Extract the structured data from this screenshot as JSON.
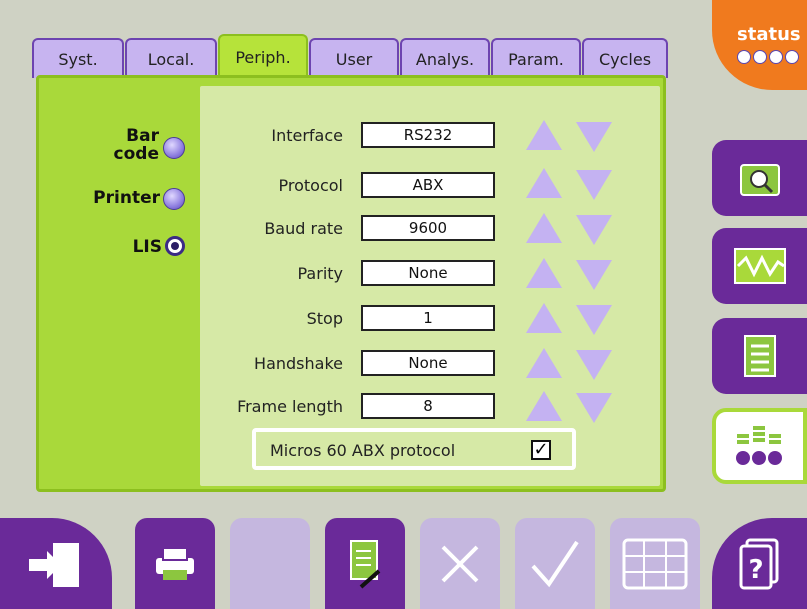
{
  "tabs": [
    "Syst.",
    "Local.",
    "Periph.",
    "User",
    "Analys.",
    "Param.",
    "Cycles"
  ],
  "active_tab": "Periph.",
  "peripherals": [
    {
      "label": "Bar code",
      "selected": false
    },
    {
      "label": "Printer",
      "selected": false
    },
    {
      "label": "LIS",
      "selected": true
    }
  ],
  "fields": [
    {
      "label": "Interface",
      "value": "RS232"
    },
    {
      "label": "Protocol",
      "value": "ABX"
    },
    {
      "label": "Baud rate",
      "value": "9600"
    },
    {
      "label": "Parity",
      "value": "None"
    },
    {
      "label": "Stop",
      "value": "1"
    },
    {
      "label": "Handshake",
      "value": "None"
    },
    {
      "label": "Frame length",
      "value": "8"
    }
  ],
  "checkbox": {
    "label": "Micros 60 ABX protocol",
    "checked": true
  },
  "status": {
    "label": "status"
  },
  "side_buttons": [
    "folder-search-icon",
    "waveform-icon",
    "list-icon",
    "settings-bars-icon"
  ],
  "bottom_buttons": [
    "exit-icon",
    "printer-icon",
    "blank",
    "document-edit-icon",
    "cancel-icon",
    "validate-icon",
    "keyboard-icon"
  ],
  "colors": {
    "accent_green": "#a9d93a",
    "purple": "#6a2a99",
    "lavender": "#c7b4f0",
    "orange": "#f07a1e"
  }
}
